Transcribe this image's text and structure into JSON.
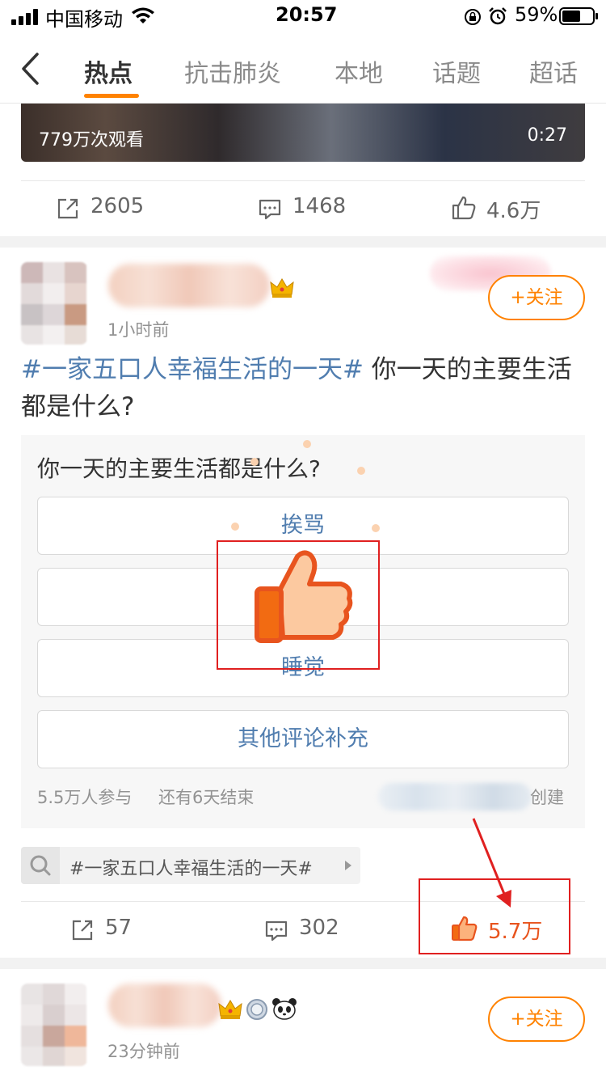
{
  "status_bar": {
    "carrier": "中国移动",
    "time": "20:57",
    "battery_percent": "59%"
  },
  "nav": {
    "back_icon": "chevron-left-icon",
    "tabs": [
      {
        "label": "热点",
        "active": true
      },
      {
        "label": "抗击肺炎",
        "active": false
      },
      {
        "label": "本地",
        "active": false
      },
      {
        "label": "话题",
        "active": false
      },
      {
        "label": "超话",
        "active": false
      }
    ],
    "accent_color": "#ff8200"
  },
  "video": {
    "views": "779万次观看",
    "duration": "0:27"
  },
  "post1_actions": {
    "repost": "2605",
    "comment": "1468",
    "like": "4.6万"
  },
  "post2": {
    "time": "1小时前",
    "follow_label": "+关注",
    "topic": "#一家五口人幸福生活的一天#",
    "text": " 你一天的主要生活都是什么?",
    "poll": {
      "question": "你一天的主要生活都是什么?",
      "options": [
        "挨骂",
        "",
        "睡觉",
        "其他评论补充"
      ],
      "participants": "5.5万人参与",
      "remaining": "还有6天结束",
      "created_suffix": "创建"
    },
    "topic_tag": "#一家五口人幸福生活的一天#",
    "actions": {
      "repost": "57",
      "comment": "302",
      "like": "5.7万"
    }
  },
  "post3": {
    "time": "23分钟前",
    "follow_label": "+关注"
  },
  "colors": {
    "link": "#507daf",
    "like_active": "#e8541e",
    "annotation_red": "#e02020"
  }
}
